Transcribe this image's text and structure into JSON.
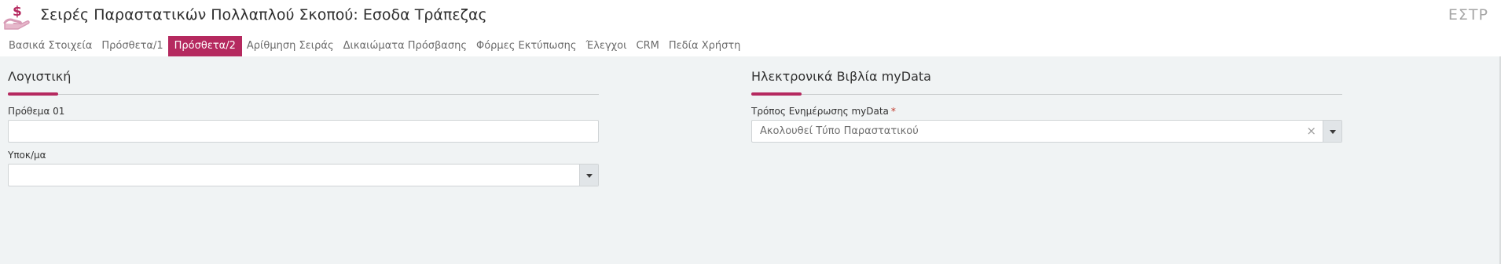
{
  "header": {
    "title": "Σειρές Παραστατικών Πολλαπλού Σκοπού: Εσοδα Τράπεζας",
    "code": "ΕΣΤΡ",
    "logo_icon": "money-hand-icon"
  },
  "tabs": [
    {
      "label": "Βασικά Στοιχεία",
      "active": false
    },
    {
      "label": "Πρόσθετα/1",
      "active": false
    },
    {
      "label": "Πρόσθετα/2",
      "active": true
    },
    {
      "label": "Αρίθμηση Σειράς",
      "active": false
    },
    {
      "label": "Δικαιώματα Πρόσβασης",
      "active": false
    },
    {
      "label": "Φόρμες Εκτύπωσης",
      "active": false
    },
    {
      "label": "Έλεγχοι",
      "active": false
    },
    {
      "label": "CRM",
      "active": false
    },
    {
      "label": "Πεδία Χρήστη",
      "active": false
    }
  ],
  "accounting": {
    "title": "Λογιστική",
    "prefix_label": "Πρόθεμα 01",
    "prefix_value": "",
    "subaccount_label": "Υποκ/μα",
    "subaccount_value": ""
  },
  "mydata": {
    "title": "Ηλεκτρονικά Βιβλία myData",
    "mode_label": "Τρόπος Ενημέρωσης myData",
    "required_mark": "*",
    "mode_value": "Ακολουθεί Τύπο Παραστατικού",
    "clear_symbol": "×"
  },
  "colors": {
    "accent": "#b5295f",
    "background": "#f0f3f4"
  }
}
